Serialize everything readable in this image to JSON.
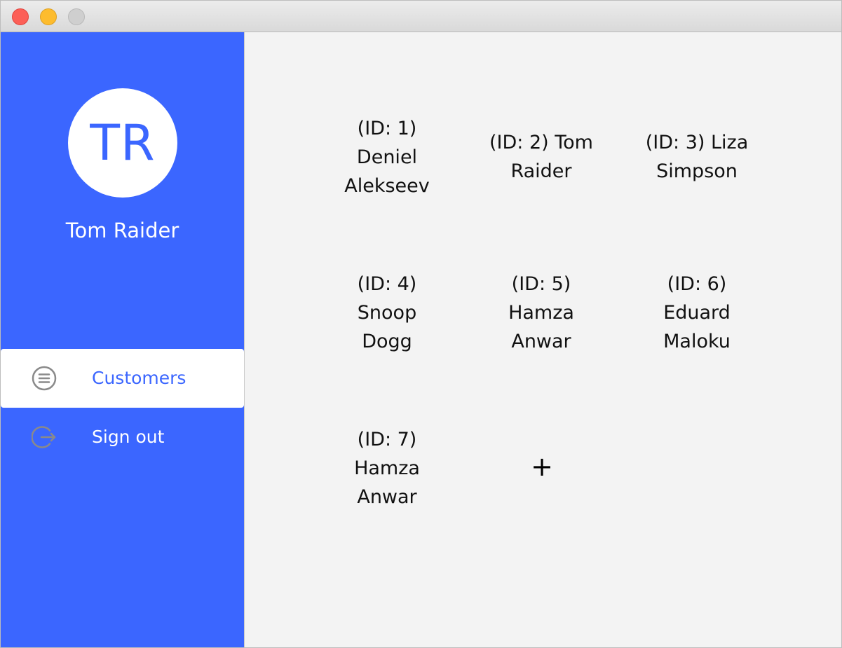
{
  "window": {
    "controls": [
      "close",
      "minimize",
      "zoom"
    ]
  },
  "colors": {
    "sidebar": "#3b66ff",
    "content_bg": "#f3f3f3",
    "accent": "#3b66ff",
    "nav_icon": "#8a8a8a"
  },
  "user": {
    "initials": "TR",
    "name": "Tom Raider"
  },
  "nav": {
    "items": [
      {
        "label": "Customers",
        "icon": "list-circle-icon",
        "active": true
      },
      {
        "label": "Sign out",
        "icon": "sign-out-icon",
        "active": false
      }
    ]
  },
  "customers": [
    {
      "id_label": "(ID: 1)",
      "name_line1": "Deniel",
      "name_line2": "Alekseev"
    },
    {
      "id_label": "(ID: 2) Tom",
      "name_line1": "Raider",
      "name_line2": ""
    },
    {
      "id_label": "(ID: 3) Liza",
      "name_line1": "Simpson",
      "name_line2": ""
    },
    {
      "id_label": "(ID: 4)",
      "name_line1": "Snoop",
      "name_line2": "Dogg"
    },
    {
      "id_label": "(ID: 5)",
      "name_line1": "Hamza",
      "name_line2": "Anwar"
    },
    {
      "id_label": "(ID: 6)",
      "name_line1": "Eduard",
      "name_line2": "Maloku"
    },
    {
      "id_label": "(ID: 7)",
      "name_line1": "Hamza",
      "name_line2": "Anwar"
    }
  ],
  "add_button": {
    "label": "+"
  }
}
